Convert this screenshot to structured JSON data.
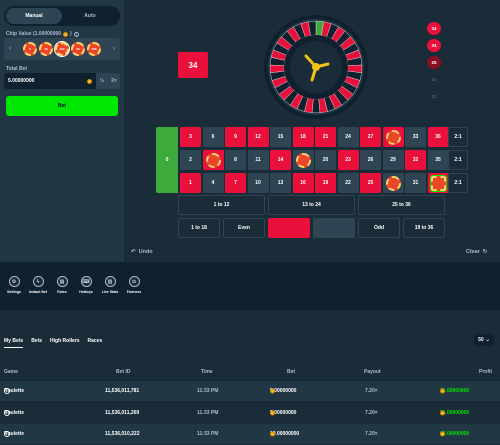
{
  "mode_tabs": [
    "Manual",
    "Auto"
  ],
  "chip_value_label": "Chip Value (1.00000000",
  "chips": [
    "1",
    "10",
    "100",
    "1K",
    "10K"
  ],
  "total_bet_label": "Total Bet",
  "total_bet_value": "5.00000000",
  "multipliers": [
    "½",
    "2×"
  ],
  "bet_button": "Bet",
  "result": "34",
  "history": [
    {
      "value": "34",
      "style": "red"
    },
    {
      "value": "34",
      "style": "red"
    },
    {
      "value": "25",
      "style": "darkred"
    },
    {
      "value": "10",
      "style": "dim"
    },
    {
      "value": "22",
      "style": "dim"
    }
  ],
  "zero": "0",
  "rows": [
    [
      3,
      6,
      9,
      12,
      15,
      18,
      21,
      24,
      27,
      30,
      33,
      36
    ],
    [
      2,
      5,
      8,
      11,
      14,
      17,
      20,
      23,
      26,
      29,
      32,
      35
    ],
    [
      1,
      4,
      7,
      10,
      13,
      16,
      19,
      22,
      25,
      28,
      31,
      34
    ]
  ],
  "red_numbers": [
    1,
    3,
    5,
    7,
    9,
    12,
    14,
    16,
    18,
    19,
    21,
    23,
    25,
    27,
    30,
    32,
    34,
    36
  ],
  "columns": [
    "2:1",
    "2:1",
    "2:1"
  ],
  "dozens": [
    "1 to 12",
    "13 to 24",
    "25 to 36"
  ],
  "outside": [
    "1 to 18",
    "Even",
    "",
    "",
    "Odd",
    "19 to 36"
  ],
  "undo": "Undo",
  "clear": "Clear",
  "tools": [
    "Settings",
    "Instant Bet",
    "Rules",
    "Hotkeys",
    "Live Stats",
    "Fairness"
  ],
  "bets_tabs": [
    "My Bets",
    "Bets",
    "High Rollers",
    "Races"
  ],
  "count": "50",
  "headers": {
    "game": "Game",
    "bet_id": "Bet ID",
    "time": "Time",
    "bet": "Bet",
    "payout": "Payout",
    "profit": "Profit"
  },
  "bets": [
    {
      "game": "Roulette",
      "id": "11,536,011,781",
      "time": "11:33 PM",
      "bet": "5.00000000",
      "payout": "7.20×",
      "profit": "31.00000000"
    },
    {
      "game": "Roulette",
      "id": "11,536,011,269",
      "time": "11:33 PM",
      "bet": "5.00000000",
      "payout": "7.20×",
      "profit": "31.00000000"
    },
    {
      "game": "Roulette",
      "id": "11,536,010,222",
      "time": "11:33 PM",
      "bet": "10.00000000",
      "payout": "7.20×",
      "profit": "62.00000000"
    }
  ],
  "colors": {
    "red": "#e9113c",
    "black": "#2f4553",
    "green": "#00e701",
    "zero_green": "#3cab3c"
  }
}
